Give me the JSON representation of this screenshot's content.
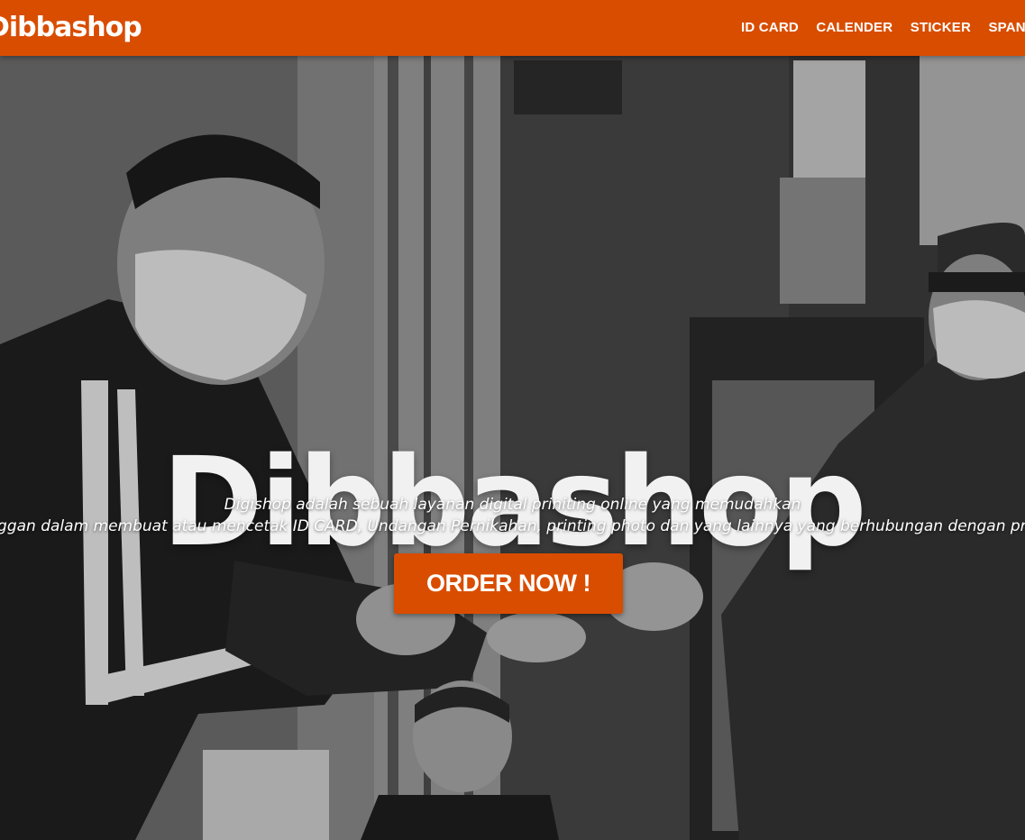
{
  "navbar": {
    "brand": "Dibbashop",
    "links": [
      "ID CARD",
      "CALENDER",
      "STICKER",
      "SPANDUK"
    ],
    "color": "#d94d00"
  },
  "hero": {
    "title": "Dibbashop",
    "subtitle_line1": "Digishop adalah sebuah layanan digital priniting online yang memudahkan",
    "subtitle_line2": "pelanggan dalam membuat atau mencetak ID CARD, Undangan Pernikahan, printing photo dan yang lainnya yang berhubungan dengan printing",
    "button_label": "ORDER NOW !"
  },
  "icons": [
    "hero-photo"
  ]
}
